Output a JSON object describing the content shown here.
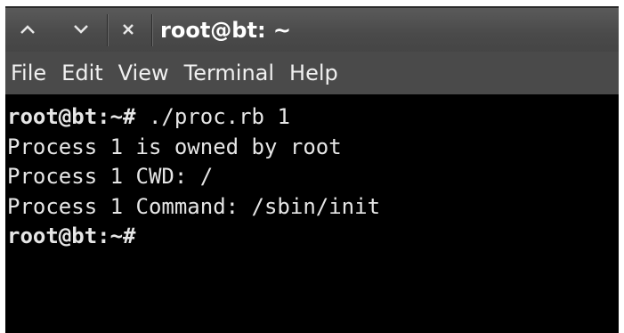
{
  "titlebar": {
    "title": "root@bt: ~",
    "buttons": {
      "up_glyph": "^",
      "down_glyph": "v",
      "close_glyph": "×"
    }
  },
  "menubar": {
    "items": [
      "File",
      "Edit",
      "View",
      "Terminal",
      "Help"
    ]
  },
  "terminal": {
    "lines": [
      {
        "prompt": "root@bt:~#",
        "text": " ./proc.rb 1"
      },
      {
        "prompt": "",
        "text": "Process 1 is owned by root"
      },
      {
        "prompt": "",
        "text": "Process 1 CWD: /"
      },
      {
        "prompt": "",
        "text": "Process 1 Command: /sbin/init"
      },
      {
        "prompt": "root@bt:~#",
        "text": ""
      }
    ]
  },
  "colors": {
    "titlebar_bg": "#4a4a4a",
    "terminal_bg": "#000000",
    "terminal_fg": "#e6e6e6"
  }
}
